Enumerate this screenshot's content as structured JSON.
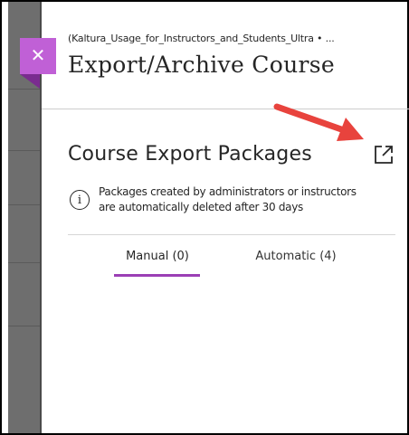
{
  "panel": {
    "breadcrumb": "(Kaltura_Usage_for_Instructors_and_Students_Ultra • ...",
    "title": "Export/Archive Course",
    "close_icon": "close-icon",
    "accent_color": "#c060d6"
  },
  "section": {
    "title": "Course Export Packages",
    "external_icon": "open-external-icon",
    "info_icon": "info-icon",
    "info_text_line1": "Packages created by administrators or instructors",
    "info_text_line2": "are automatically deleted after 30 days"
  },
  "tabs": [
    {
      "label": "Manual (0)",
      "selected": true
    },
    {
      "label": "Automatic (4)",
      "selected": false
    }
  ],
  "annotation": {
    "arrow_color": "#e8433d"
  }
}
